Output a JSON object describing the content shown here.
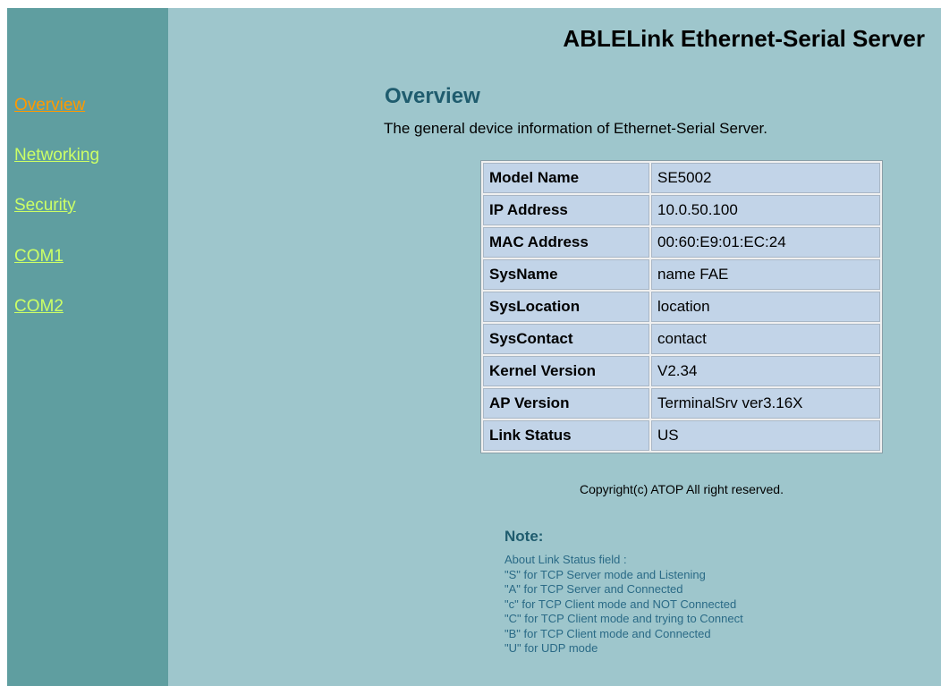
{
  "header": {
    "title": "ABLELink Ethernet-Serial Server"
  },
  "sidebar": {
    "items": [
      {
        "label": "Overview",
        "active": true
      },
      {
        "label": "Networking",
        "active": false
      },
      {
        "label": "Security",
        "active": false
      },
      {
        "label": "COM1",
        "active": false
      },
      {
        "label": "COM2",
        "active": false
      }
    ]
  },
  "main": {
    "title": "Overview",
    "description": "The general device information of Ethernet-Serial Server.",
    "table": {
      "rows": [
        {
          "label": "Model Name",
          "value": "SE5002"
        },
        {
          "label": "IP Address",
          "value": "10.0.50.100"
        },
        {
          "label": "MAC Address",
          "value": "00:60:E9:01:EC:24"
        },
        {
          "label": "SysName",
          "value": "name FAE"
        },
        {
          "label": "SysLocation",
          "value": "location"
        },
        {
          "label": "SysContact",
          "value": "contact"
        },
        {
          "label": "Kernel Version",
          "value": "V2.34"
        },
        {
          "label": "AP Version",
          "value": "TerminalSrv ver3.16X"
        },
        {
          "label": "Link Status",
          "value": "US"
        }
      ]
    },
    "copyright": "Copyright(c) ATOP All right reserved.",
    "note": {
      "title": "Note:",
      "lines": [
        "About Link Status field :",
        "\"S\" for TCP Server mode and Listening",
        "\"A\" for TCP Server and Connected",
        "\"c\" for TCP Client mode and NOT Connected",
        "\"C\" for TCP Client mode and trying to Connect",
        "\"B\" for TCP Client mode and Connected",
        "\"U\" for UDP mode"
      ]
    }
  },
  "colors": {
    "sidebar_bg": "#5f9ea0",
    "content_bg": "#9ec6cc",
    "link": "#ccff66",
    "link_active": "#ff9900",
    "heading": "#1f5c6e",
    "table_cell": "#c2d4e8"
  }
}
